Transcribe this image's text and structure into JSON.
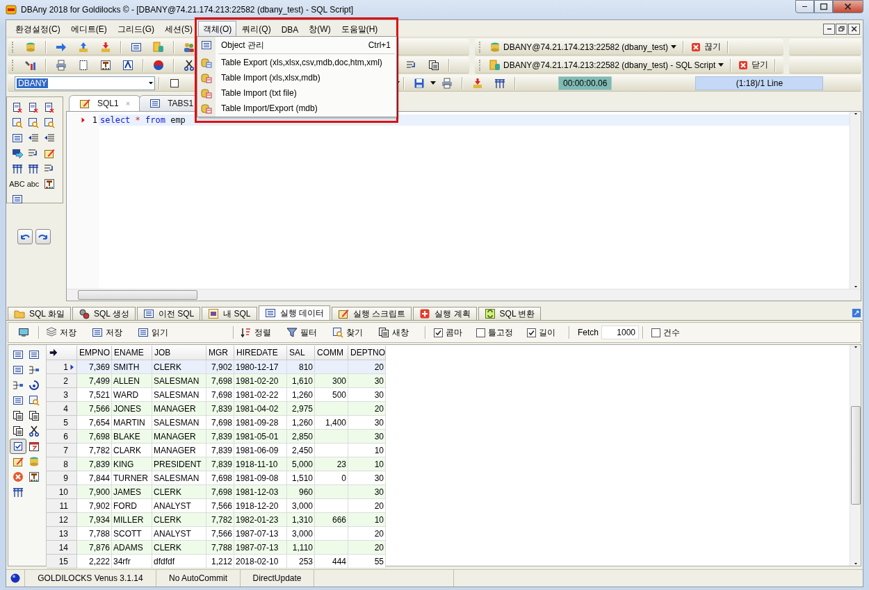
{
  "window": {
    "title": "DBAny 2018 for Goldilocks © - [DBANY@74.21.174.213:22582 (dbany_test) - SQL Script]"
  },
  "menu_bar": [
    {
      "label": "환경설정(C)",
      "selected": false
    },
    {
      "label": "에디트(E)",
      "selected": false
    },
    {
      "label": "그리드(G)",
      "selected": false
    },
    {
      "label": "세션(S)",
      "selected": false
    },
    {
      "label": "객체(O)",
      "selected": true
    },
    {
      "label": "쿼리(Q)",
      "selected": false
    },
    {
      "label": "DBA",
      "selected": false
    },
    {
      "label": "창(W)",
      "selected": false
    },
    {
      "label": "도움말(H)",
      "selected": false
    }
  ],
  "open_menu": {
    "highlighted_frame": true,
    "items": [
      {
        "label": "Object 관리",
        "shortcut": "Ctrl+1",
        "kind": "list"
      },
      {
        "label": "Table Export (xls,xlsx,csv,mdb,doc,htm,xml)",
        "kind": "export"
      },
      {
        "label": "Table Import (xls,xlsx,mdb)",
        "kind": "import"
      },
      {
        "label": "Table Import (txt file)",
        "kind": "import"
      },
      {
        "label": "Table Import/Export (mdb)",
        "kind": "import"
      }
    ]
  },
  "connection_bar": {
    "connection": "DBANY@74.21.174.213:22582 (dbany_test)",
    "disconnect": "끊기"
  },
  "script_bar": {
    "script": "DBANY@74.21.174.213:22582 (dbany_test) - SQL Script",
    "close": "닫기"
  },
  "query_bar": {
    "connection_combo": "DBANY",
    "elapsed": "00:00:00.06",
    "position": "(1:18)/1 Line"
  },
  "side_tools": {
    "text_buttons": [
      "ABC",
      "abc"
    ]
  },
  "editor": {
    "tabs": [
      {
        "label": "SQL1",
        "selected": true,
        "close_label": "×"
      },
      {
        "label": "TABS1",
        "selected": false
      }
    ],
    "lines": [
      {
        "number": "1",
        "current": true,
        "tokens": [
          {
            "text": "select",
            "kind": "keyword"
          },
          {
            "text": "*",
            "kind": "operator"
          },
          {
            "text": "from",
            "kind": "keyword"
          },
          {
            "text": "emp",
            "kind": "identifier"
          }
        ]
      }
    ]
  },
  "result_tabs": [
    {
      "label": "SQL 화일",
      "selected": false
    },
    {
      "label": "SQL 생성",
      "selected": false
    },
    {
      "label": "이전 SQL",
      "selected": false
    },
    {
      "label": "내 SQL",
      "selected": false
    },
    {
      "label": "실행 데이터",
      "selected": true
    },
    {
      "label": "실행 스크립트",
      "selected": false
    },
    {
      "label": "실행 계획",
      "selected": false
    },
    {
      "label": "SQL 변환",
      "selected": false
    }
  ],
  "result_toolbar": {
    "buttons": [
      "저장",
      "저장",
      "읽기"
    ],
    "tools": [
      "정렬",
      "필터",
      "찾기",
      "새창"
    ],
    "options": [
      {
        "label": "콤마",
        "checked": true
      },
      {
        "label": "틀고정",
        "checked": false
      },
      {
        "label": "길이",
        "checked": true
      }
    ],
    "fetch_label": "Fetch",
    "fetch_value": "1000",
    "count_option": {
      "label": "건수",
      "checked": false
    }
  },
  "grid": {
    "columns": [
      "EMPNO",
      "ENAME",
      "JOB",
      "MGR",
      "HIREDATE",
      "SAL",
      "COMM",
      "DEPTNO"
    ],
    "rows": [
      {
        "number": "1",
        "selected": true,
        "cells": [
          "7,369",
          "SMITH",
          "CLERK",
          "7,902",
          "1980-12-17",
          "810",
          "",
          "20"
        ]
      },
      {
        "number": "2",
        "selected": false,
        "cells": [
          "7,499",
          "ALLEN",
          "SALESMAN",
          "7,698",
          "1981-02-20",
          "1,610",
          "300",
          "30"
        ]
      },
      {
        "number": "3",
        "selected": false,
        "cells": [
          "7,521",
          "WARD",
          "SALESMAN",
          "7,698",
          "1981-02-22",
          "1,260",
          "500",
          "30"
        ]
      },
      {
        "number": "4",
        "selected": false,
        "cells": [
          "7,566",
          "JONES",
          "MANAGER",
          "7,839",
          "1981-04-02",
          "2,975",
          "",
          "20"
        ]
      },
      {
        "number": "5",
        "selected": false,
        "cells": [
          "7,654",
          "MARTIN",
          "SALESMAN",
          "7,698",
          "1981-09-28",
          "1,260",
          "1,400",
          "30"
        ]
      },
      {
        "number": "6",
        "selected": false,
        "cells": [
          "7,698",
          "BLAKE",
          "MANAGER",
          "7,839",
          "1981-05-01",
          "2,850",
          "",
          "30"
        ]
      },
      {
        "number": "7",
        "selected": false,
        "cells": [
          "7,782",
          "CLARK",
          "MANAGER",
          "7,839",
          "1981-06-09",
          "2,450",
          "",
          "10"
        ]
      },
      {
        "number": "8",
        "selected": false,
        "cells": [
          "7,839",
          "KING",
          "PRESIDENT",
          "7,839",
          "1918-11-10",
          "5,000",
          "23",
          "10"
        ]
      },
      {
        "number": "9",
        "selected": false,
        "cells": [
          "7,844",
          "TURNER",
          "SALESMAN",
          "7,698",
          "1981-09-08",
          "1,510",
          "0",
          "30"
        ]
      },
      {
        "number": "10",
        "selected": false,
        "cells": [
          "7,900",
          "JAMES",
          "CLERK",
          "7,698",
          "1981-12-03",
          "960",
          "",
          "30"
        ]
      },
      {
        "number": "11",
        "selected": false,
        "cells": [
          "7,902",
          "FORD",
          "ANALYST",
          "7,566",
          "1918-12-20",
          "3,000",
          "",
          "20"
        ]
      },
      {
        "number": "12",
        "selected": false,
        "cells": [
          "7,934",
          "MILLER",
          "CLERK",
          "7,782",
          "1982-01-23",
          "1,310",
          "666",
          "10"
        ]
      },
      {
        "number": "13",
        "selected": false,
        "cells": [
          "7,788",
          "SCOTT",
          "ANALYST",
          "7,566",
          "1987-07-13",
          "3,000",
          "",
          "20"
        ]
      },
      {
        "number": "14",
        "selected": false,
        "cells": [
          "7,876",
          "ADAMS",
          "CLERK",
          "7,788",
          "1987-07-13",
          "1,110",
          "",
          "20"
        ]
      },
      {
        "number": "15",
        "selected": false,
        "cells": [
          "2,222",
          "34rfr",
          "dfdfdf",
          "1,212",
          "2018-02-10",
          "253",
          "444",
          "55"
        ]
      }
    ]
  },
  "status_bar": [
    "GOLDILOCKS Venus 3.1.14",
    "No AutoCommit",
    "DirectUpdate"
  ]
}
